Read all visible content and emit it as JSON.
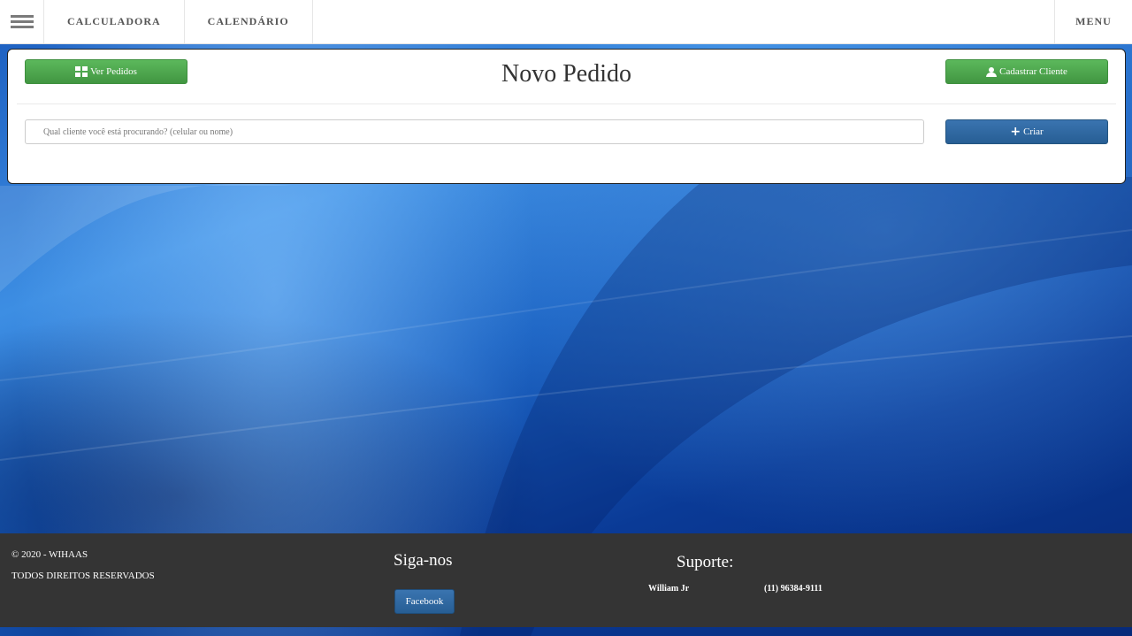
{
  "nav": {
    "links": [
      "CALCULADORA",
      "CALENDÁRIO"
    ],
    "menu_label": "MENU"
  },
  "panel": {
    "title": "Novo Pedido",
    "ver_pedidos_label": "Ver Pedidos",
    "cadastrar_label": "Cadastrar Cliente",
    "search_placeholder": "Qual cliente você está procurando? (celular ou nome)",
    "search_value": "",
    "criar_label": "Criar"
  },
  "footer": {
    "copyright": "© 2020 - WIHAAS",
    "rights": "TODOS DIREITOS RESERVADOS",
    "follow_title": "Siga-nos",
    "facebook_label": "Facebook",
    "support_title": "Suporte:",
    "support_name": "William Jr",
    "support_phone": "(11) 96384-9111"
  },
  "colors": {
    "green_button": "#5cb85c",
    "blue_button": "#337ab7",
    "footer_bg": "#343434",
    "nav_text": "#555555"
  },
  "icons": {
    "burger": "hamburger-icon",
    "ver_pedidos": "grid-icon",
    "cadastrar": "user-icon",
    "criar": "plus-icon"
  }
}
